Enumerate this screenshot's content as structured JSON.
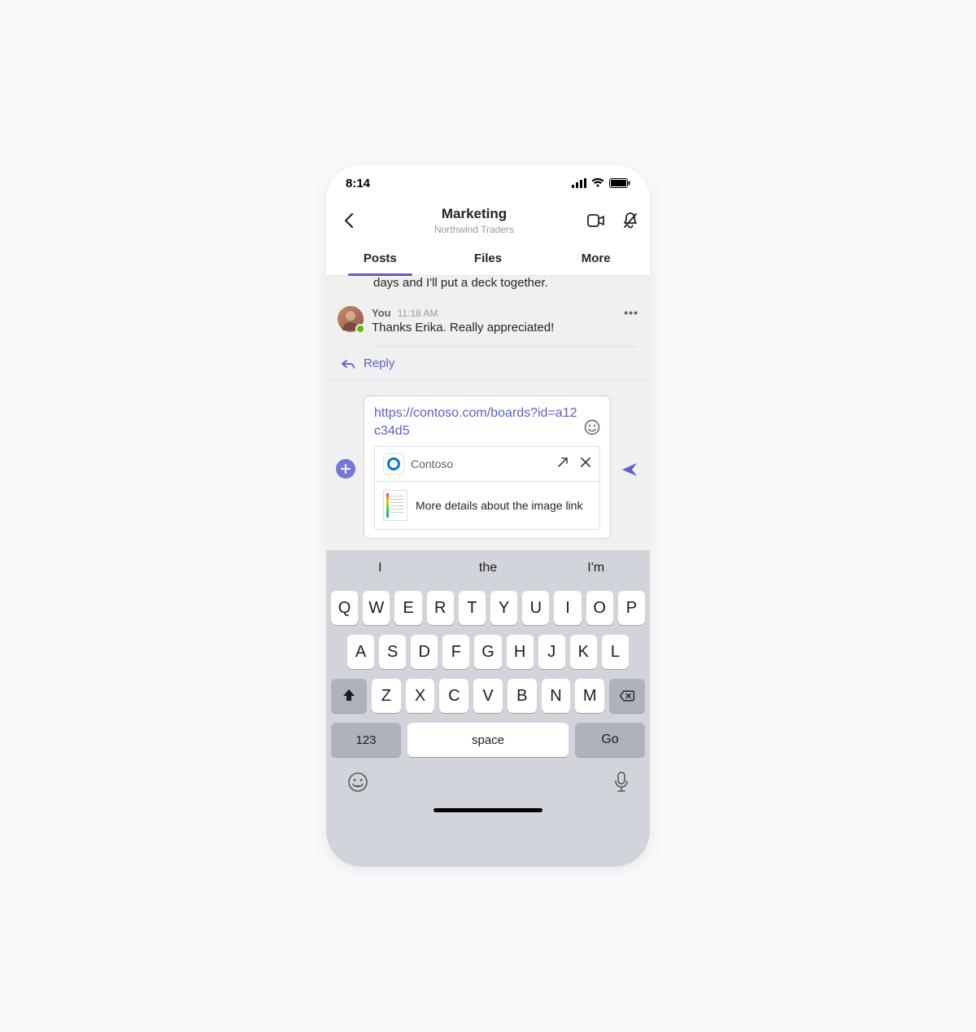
{
  "status": {
    "time": "8:14"
  },
  "header": {
    "title": "Marketing",
    "subtitle": "Northwind Traders"
  },
  "tabs": {
    "posts": "Posts",
    "files": "Files",
    "more": "More"
  },
  "thread": {
    "truncated": "days and I'll put a deck together.",
    "msg": {
      "author": "You",
      "time": "11:18 AM",
      "text": "Thanks Erika. Really appreciated!"
    },
    "reply": "Reply"
  },
  "compose": {
    "text": "https://contoso.com/boards?id=a12c34d5",
    "card": {
      "app": "Contoso",
      "desc": "More details about the image link"
    }
  },
  "keyboard": {
    "suggestions": [
      "I",
      "the",
      "I'm"
    ],
    "row1": [
      "Q",
      "W",
      "E",
      "R",
      "T",
      "Y",
      "U",
      "I",
      "O",
      "P"
    ],
    "row2": [
      "A",
      "S",
      "D",
      "F",
      "G",
      "H",
      "J",
      "K",
      "L"
    ],
    "row3": [
      "Z",
      "X",
      "C",
      "V",
      "B",
      "N",
      "M"
    ],
    "numKey": "123",
    "spaceKey": "space",
    "goKey": "Go"
  }
}
